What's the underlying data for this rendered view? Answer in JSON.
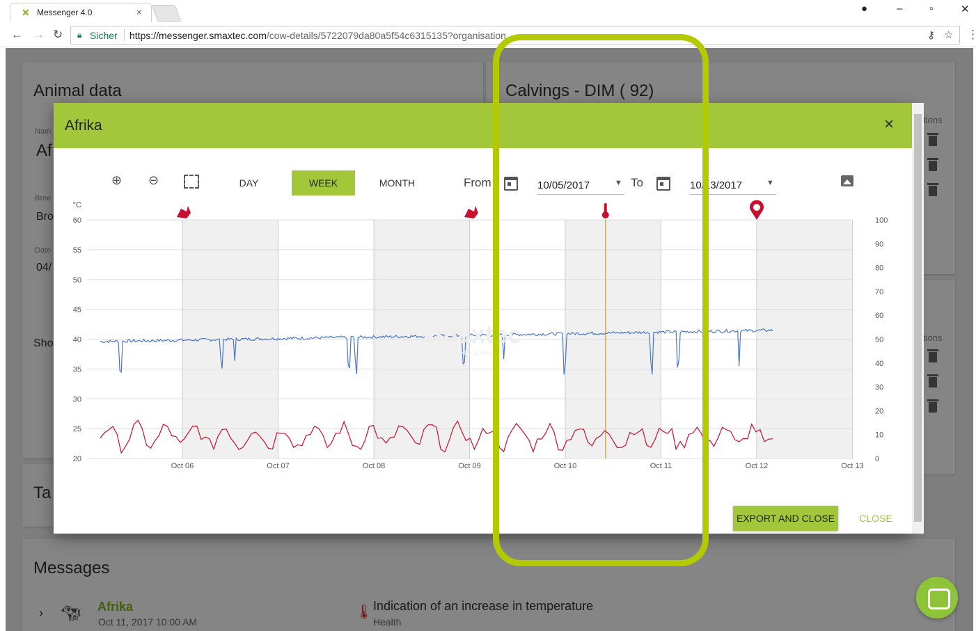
{
  "browser": {
    "tab_title": "Messenger 4.0",
    "tab_close": "×",
    "secure_label": "Sicher",
    "url_host": "https://messenger.smaxtec.com",
    "url_path": "/cow-details/5722079da80a5f54c6315135?organisation"
  },
  "background": {
    "animal_card_title": "Animal data",
    "name_label": "Nam",
    "name_value": "Af",
    "breed_label": "Bree",
    "breed_value": "Bro",
    "date_label": "Date",
    "date_value": "04/",
    "show_label": "Sho",
    "calvings_title": "Calvings - DIM ( 92)",
    "actions_label_1": "tions",
    "actions_label_2": "tions",
    "tab_title_partial": "Ta",
    "messages_title": "Messages",
    "message": {
      "name": "Afrika",
      "time": "Oct 11, 2017 10:00 AM",
      "text": "Indication of an increase in temperature",
      "category": "Health"
    }
  },
  "modal": {
    "title": "Afrika",
    "close_icon": "×",
    "ranges": [
      "DAY",
      "WEEK",
      "MONTH"
    ],
    "active_range": "WEEK",
    "from_label": "From",
    "from_date": "10/05/2017",
    "to_label": "To",
    "to_date": "10/13/2017",
    "export_label": "EXPORT AND CLOSE",
    "close_label": "CLOSE",
    "watermark": "smaxtec",
    "watermark_sub": "ANIMAL CARE"
  },
  "chart_data": {
    "type": "line",
    "x_range": [
      "Oct 05",
      "Oct 13"
    ],
    "x_ticks": [
      "Oct 06",
      "Oct 07",
      "Oct 08",
      "Oct 09",
      "Oct 10",
      "Oct 11",
      "Oct 12",
      "Oct 13"
    ],
    "y_left": {
      "unit": "°C",
      "ticks": [
        20,
        25,
        30,
        35,
        40,
        45,
        50,
        55,
        60
      ],
      "range": [
        20,
        60
      ]
    },
    "y_right": {
      "ticks": [
        0,
        10,
        20,
        30,
        40,
        50,
        60,
        70,
        80,
        90,
        100
      ],
      "range": [
        0,
        100
      ]
    },
    "series": [
      {
        "axis": "left",
        "color": "#4a76c9",
        "base_start": 39.6,
        "base_end": 41.5
      },
      {
        "axis": "right",
        "color": "#c8102e",
        "base": 8
      }
    ],
    "markers": [
      "heat-icon",
      "heat-icon",
      "thermometer-icon",
      "calving-pin-icon"
    ],
    "marker_dates": [
      "Oct 06",
      "Oct 09",
      "Oct 10 14:00",
      "Oct 12"
    ],
    "vertical_line": "Oct 10 14:00",
    "vertical_line_color": "#f5a623"
  },
  "annotation_color": "#b4ca00"
}
